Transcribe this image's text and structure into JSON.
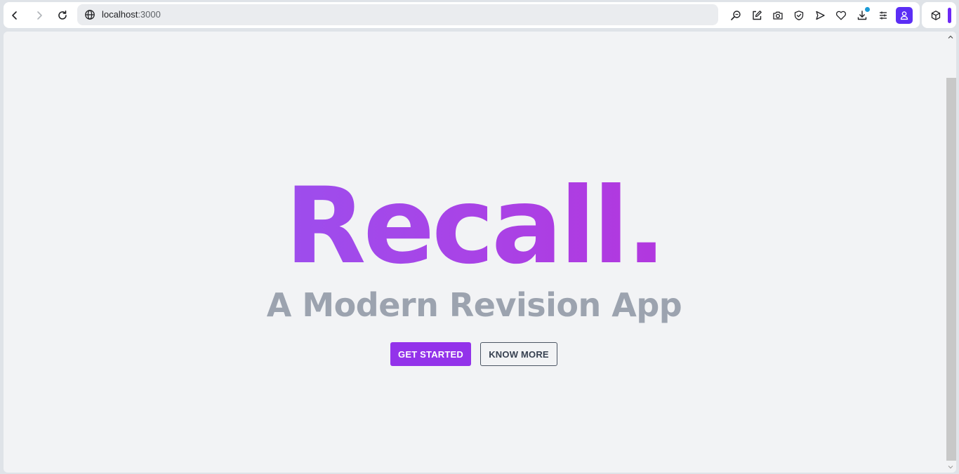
{
  "browser": {
    "url_host": "localhost",
    "url_port": ":3000",
    "toolbar_icons": [
      "zoom-search-icon",
      "edit-note-icon",
      "camera-icon",
      "shield-check-icon",
      "send-icon",
      "heart-icon",
      "download-icon",
      "tab-menu-icon"
    ],
    "profile_color": "#5b2ef5",
    "extension_bar_color": "#6d28f5"
  },
  "hero": {
    "brand": "Recall.",
    "tagline": "A Modern Revision App",
    "gradient": [
      "#8b5cf6",
      "#c026d3"
    ],
    "tagline_color": "#9ca3af"
  },
  "actions": {
    "primary_label": "GET STARTED",
    "secondary_label": "KNOW MORE",
    "primary_color": "#9333ea"
  }
}
